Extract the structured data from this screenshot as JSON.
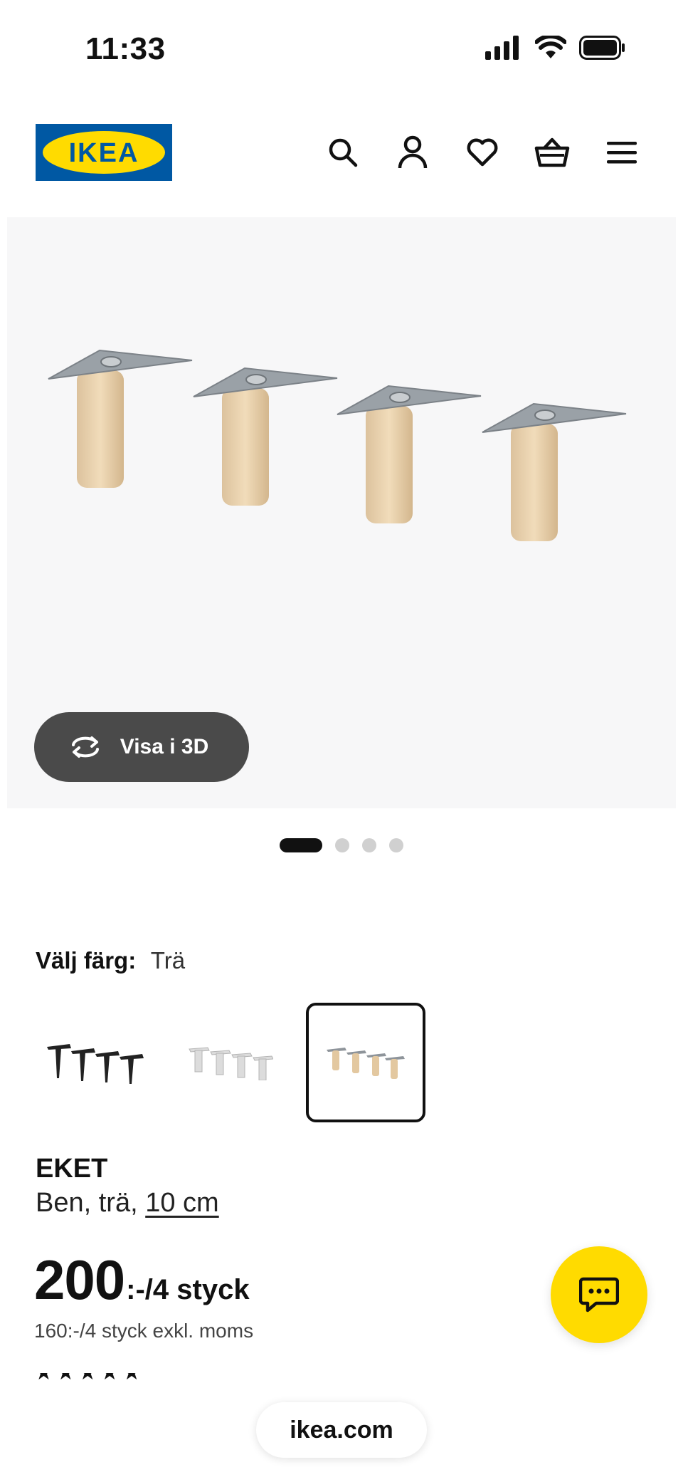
{
  "status_bar": {
    "time": "11:33"
  },
  "brand": {
    "logo_text": "IKEA",
    "logo_bg": "#0058a3",
    "logo_fg": "#ffdb00"
  },
  "header": {
    "icons": [
      "search-icon",
      "profile-icon",
      "heart-icon",
      "basket-icon",
      "menu-icon"
    ]
  },
  "gallery": {
    "view_3d_label": "Visa i 3D",
    "pagination": {
      "total": 4,
      "active_index": 0
    }
  },
  "color_picker": {
    "label": "Välj färg:",
    "selected_value": "Trä",
    "options": [
      "black-legs",
      "white-legs",
      "wood-legs"
    ],
    "selected_index": 2
  },
  "product": {
    "name": "EKET",
    "description_prefix": "Ben, trä,",
    "size_link": "10 cm",
    "price_value": "200",
    "price_unit": ":-/4 styck",
    "price_ex_vat": "160:-/4 styck exkl. moms"
  },
  "colors": {
    "accent_yellow": "#ffdb00",
    "button_dark": "#4a4a4a"
  },
  "url_bar": {
    "domain": "ikea.com"
  }
}
